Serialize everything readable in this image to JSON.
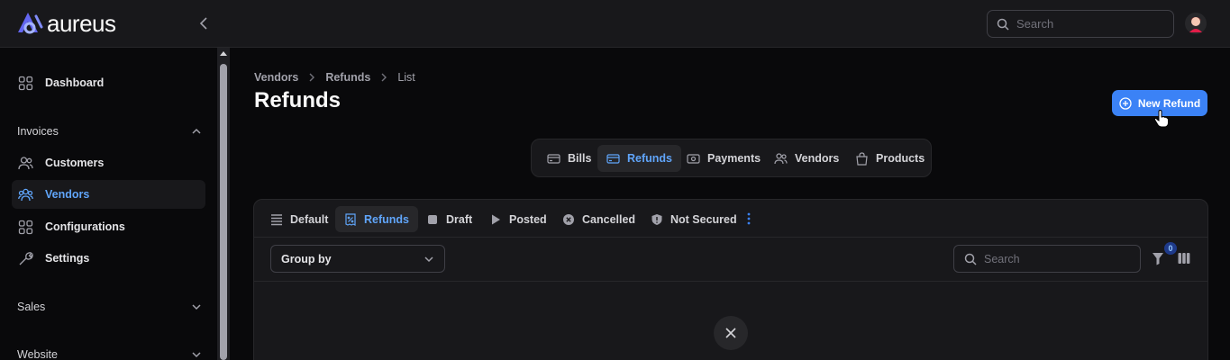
{
  "app": {
    "name": "aureus"
  },
  "header": {
    "search_placeholder": "Search"
  },
  "sidebar": {
    "items": [
      {
        "label": "Dashboard",
        "icon": "grid-icon"
      },
      {
        "label": "Customers",
        "icon": "users-icon"
      },
      {
        "label": "Vendors",
        "icon": "users-group-icon",
        "active": true
      },
      {
        "label": "Configurations",
        "icon": "grid-icon"
      },
      {
        "label": "Settings",
        "icon": "wrench-icon"
      }
    ],
    "groups": [
      {
        "label": "Invoices",
        "expanded": true
      },
      {
        "label": "Sales",
        "expanded": false
      },
      {
        "label": "Website",
        "expanded": false
      }
    ]
  },
  "breadcrumb": [
    "Vendors",
    "Refunds",
    "List"
  ],
  "page": {
    "title": "Refunds",
    "new_button": "New Refund"
  },
  "resource_tabs": [
    {
      "label": "Bills",
      "icon": "credit-card-icon"
    },
    {
      "label": "Refunds",
      "icon": "credit-card-icon",
      "active": true
    },
    {
      "label": "Payments",
      "icon": "banknote-icon"
    },
    {
      "label": "Vendors",
      "icon": "users-icon"
    },
    {
      "label": "Products",
      "icon": "shopping-bag-icon"
    }
  ],
  "filter_tabs": [
    {
      "label": "Default",
      "icon": "list-icon"
    },
    {
      "label": "Refunds",
      "icon": "receipt-percent-icon",
      "active": true
    },
    {
      "label": "Draft",
      "icon": "stop-icon"
    },
    {
      "label": "Posted",
      "icon": "play-icon"
    },
    {
      "label": "Cancelled",
      "icon": "x-circle-icon"
    },
    {
      "label": "Not Secured",
      "icon": "shield-icon"
    }
  ],
  "table": {
    "group_by_label": "Group by",
    "search_placeholder": "Search",
    "filter_count": "0"
  },
  "colors": {
    "accent": "#3b82f6",
    "accent_text": "#60a5fa",
    "background": "#09090b",
    "surface": "#18181b"
  }
}
